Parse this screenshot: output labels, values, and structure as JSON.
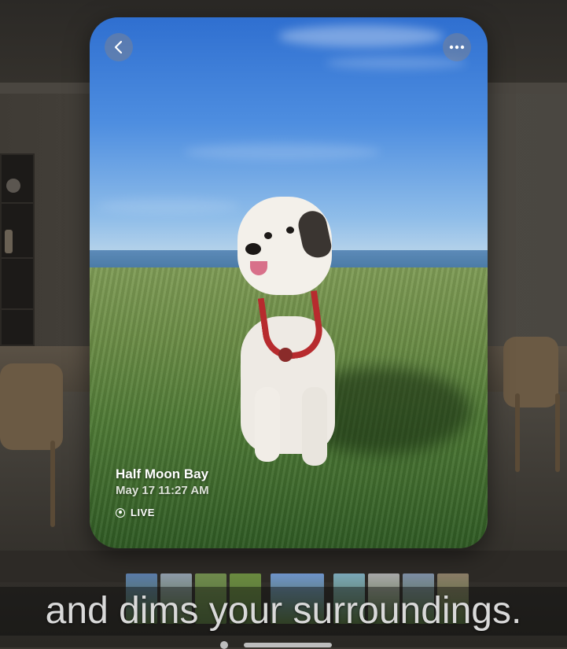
{
  "photo": {
    "location": "Half Moon Bay",
    "datetime": "May 17  11:27 AM",
    "live_label": "LIVE"
  },
  "controls": {
    "back_icon": "chevron-left-icon",
    "more_icon": "ellipsis-icon"
  },
  "thumbnails": [
    {
      "label": "thumbnail-1",
      "color": "#5a7ba8"
    },
    {
      "label": "thumbnail-2",
      "color": "#8e9aa8"
    },
    {
      "label": "thumbnail-3",
      "color": "#6f8a4c"
    },
    {
      "label": "thumbnail-4",
      "color": "#6a8a3f"
    },
    {
      "label": "thumbnail-5-selected",
      "color": "#6e93c9"
    },
    {
      "label": "thumbnail-6",
      "color": "#7ba7b8"
    },
    {
      "label": "thumbnail-7",
      "color": "#a8a8a8"
    },
    {
      "label": "thumbnail-8",
      "color": "#7d8da3"
    },
    {
      "label": "thumbnail-9",
      "color": "#8a7c66"
    }
  ],
  "subtitle": "and dims your surroundings.",
  "colors": {
    "harness": "#b72b2e",
    "sky": "#2f6fd0",
    "grass": "#4f7a36"
  }
}
